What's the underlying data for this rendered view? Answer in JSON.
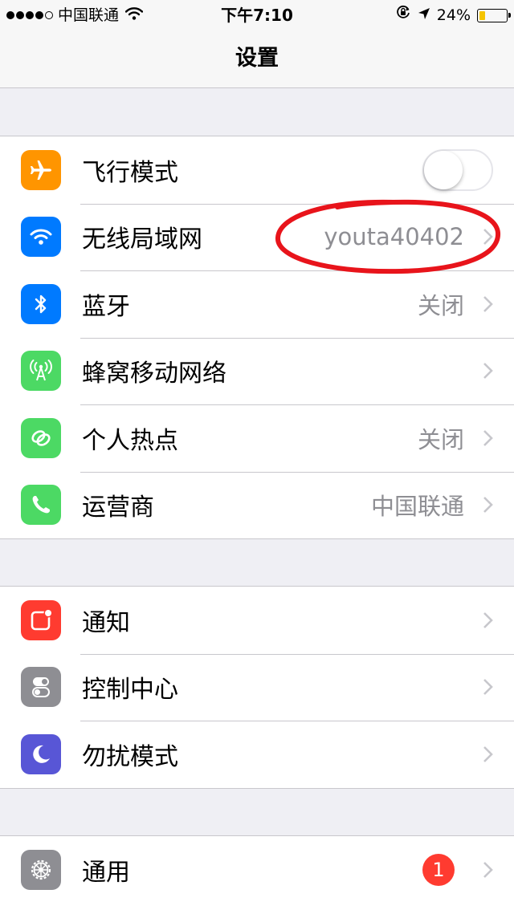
{
  "status_bar": {
    "carrier": "中国联通",
    "time": "下午7:10",
    "battery_percent_text": "24%",
    "battery_level": 0.24,
    "signal_bars": 4,
    "icons": [
      "wifi-icon",
      "rotation-lock-icon",
      "location-arrow-icon",
      "battery-icon"
    ]
  },
  "nav": {
    "title": "设置"
  },
  "groups": [
    {
      "items": [
        {
          "label": "飞行模式",
          "icon": "airplane-icon",
          "color": "#ff9500",
          "toggle": false
        },
        {
          "label": "无线局域网",
          "icon": "wifi-icon",
          "color": "#007aff",
          "value": "youta40402"
        },
        {
          "label": "蓝牙",
          "icon": "bluetooth-icon",
          "color": "#007aff",
          "value": "关闭"
        },
        {
          "label": "蜂窝移动网络",
          "icon": "cellular-antenna-icon",
          "color": "#4cd964"
        },
        {
          "label": "个人热点",
          "icon": "hotspot-link-icon",
          "color": "#4cd964",
          "value": "关闭"
        },
        {
          "label": "运营商",
          "icon": "phone-icon",
          "color": "#4cd964",
          "value": "中国联通"
        }
      ]
    },
    {
      "items": [
        {
          "label": "通知",
          "icon": "notifications-icon",
          "color": "#ff3b30"
        },
        {
          "label": "控制中心",
          "icon": "control-center-icon",
          "color": "#8e8e93"
        },
        {
          "label": "勿扰模式",
          "icon": "moon-icon",
          "color": "#5856d6"
        }
      ]
    },
    {
      "items": [
        {
          "label": "通用",
          "icon": "gear-icon",
          "color": "#8e8e93",
          "badge": "1"
        }
      ]
    }
  ],
  "annotation": {
    "color": "#e8141b",
    "shape": "hand-drawn-ellipse"
  }
}
